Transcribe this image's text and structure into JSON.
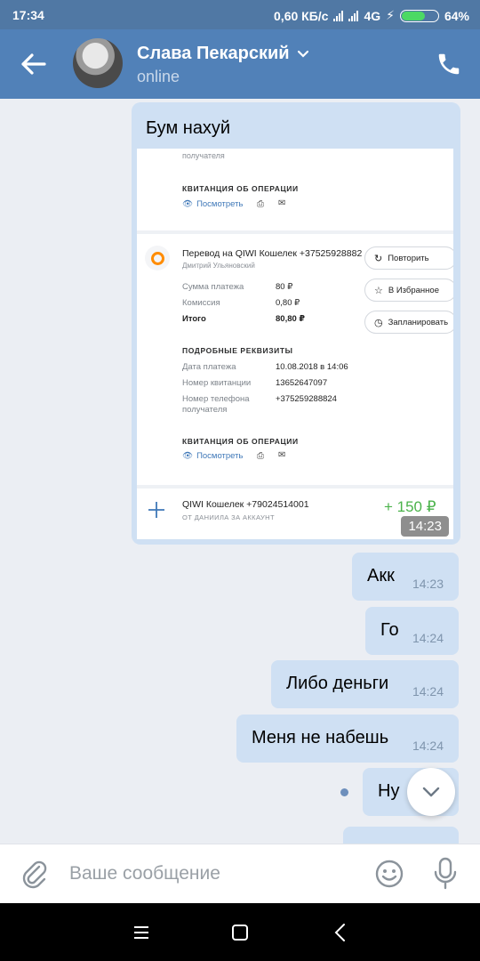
{
  "status_bar": {
    "time": "17:34",
    "speed": "0,60 КБ/с",
    "network": "4G",
    "battery": "64%",
    "battery_level": 0.64
  },
  "header": {
    "contact_name": "Слава Пекарский",
    "presence": "online"
  },
  "messages": {
    "incoming": {
      "text": "Бум нахуй",
      "time": "14:23",
      "screenshot": {
        "top_card": {
          "partial_label": "получателя",
          "receipt_heading": "КВИТАНЦИЯ ОБ ОПЕРАЦИИ",
          "view_link": "Посмотреть"
        },
        "transfer": {
          "title": "Перевод на QIWI Кошелек +37525928882",
          "subtitle": "Дмитрий Ульяновский",
          "rows": [
            {
              "label": "Сумма платежа",
              "value": "80 ₽"
            },
            {
              "label": "Комиссия",
              "value": "0,80 ₽"
            },
            {
              "label": "Итого",
              "value": "80,80 ₽"
            }
          ],
          "actions": [
            "Повторить",
            "В Избранное",
            "Запланировать"
          ],
          "details_heading": "ПОДРОБНЫЕ РЕКВИЗИТЫ",
          "details": [
            {
              "label": "Дата платежа",
              "value": "10.08.2018 в 14:06"
            },
            {
              "label": "Номер квитанции",
              "value": "13652647097"
            },
            {
              "label": "Номер телефона получателя",
              "value": "+375259288824"
            }
          ],
          "receipt_heading": "КВИТАНЦИЯ ОБ ОПЕРАЦИИ",
          "view_link": "Посмотреть"
        },
        "income": {
          "title": "QIWI Кошелек +79024514001",
          "subtitle": "ОТ ДАНИИЛА ЗА АККАУНТ",
          "amount": "+ 150 ₽"
        }
      }
    },
    "outgoing": [
      {
        "text": "Акк",
        "time": "14:23"
      },
      {
        "text": "Го",
        "time": "14:24"
      },
      {
        "text": "Либо деньги",
        "time": "14:24"
      },
      {
        "text": "Меня не набешь",
        "time": "14:24"
      },
      {
        "text": "Ну",
        "time": ""
      }
    ]
  },
  "composer": {
    "placeholder": "Ваше сообщение"
  }
}
